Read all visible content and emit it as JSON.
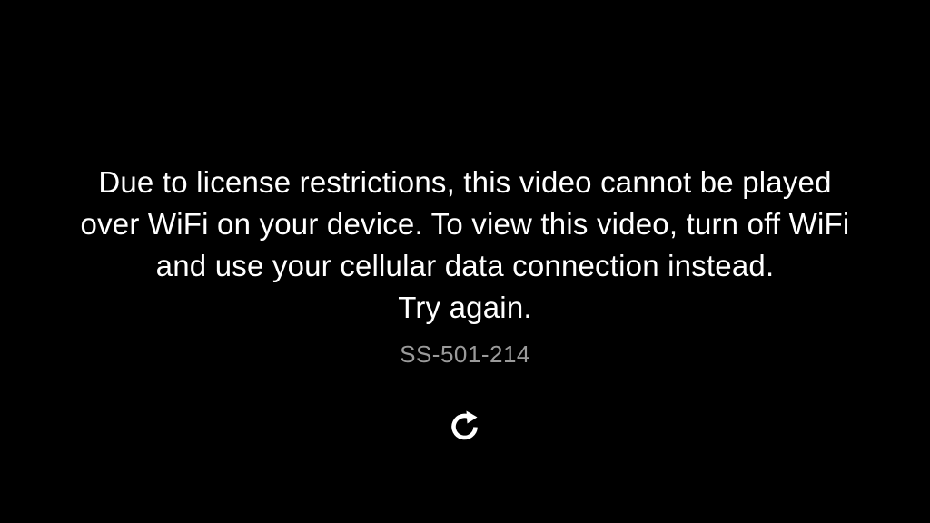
{
  "error": {
    "message_lines": [
      "Due to license restrictions, this video cannot be played",
      "over WiFi on your device. To view this video, turn off WiFi",
      "and use your cellular data connection instead.",
      "Try again."
    ],
    "code": "SS-501-214",
    "retry_icon": "refresh-icon"
  },
  "colors": {
    "background": "#000000",
    "text": "#ffffff",
    "code_text": "#9a9a9a"
  }
}
